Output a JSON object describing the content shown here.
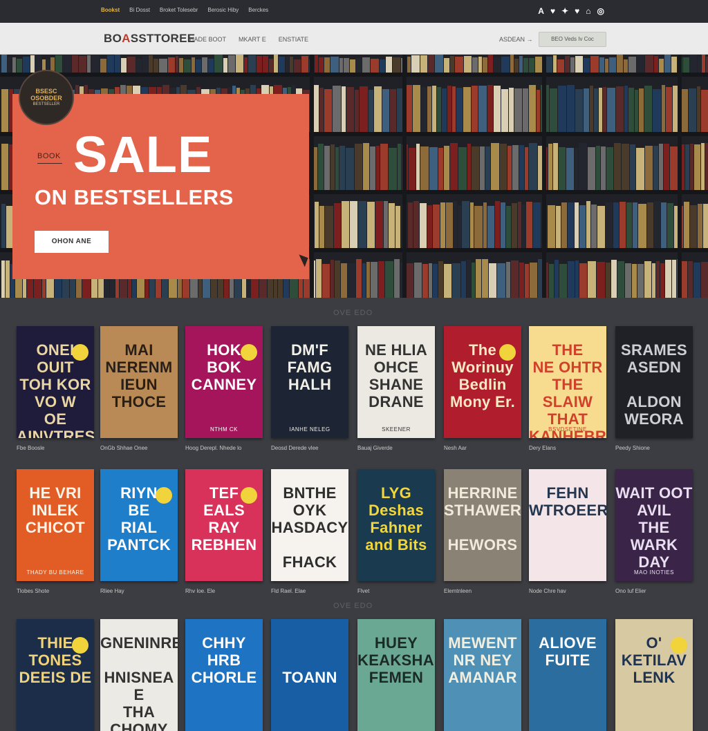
{
  "utility_bar": {
    "links": [
      "Bookst",
      "Bi Dosst",
      "Broket Tolesebr",
      "Berosic Hiby",
      "Berckes"
    ],
    "social_icons": [
      "facebook-icon",
      "twitter-icon",
      "pinterest-icon",
      "twitter-icon",
      "instagram-icon",
      "pinterest-icon"
    ],
    "social_glyphs": [
      "A",
      "♥",
      "✦",
      "♥",
      "⌂",
      "◎"
    ]
  },
  "nav": {
    "logo_prefix": "BO",
    "logo_highlight": "A",
    "logo_suffix": "SSTTOREE",
    "links": [
      "HADE BOOT",
      "MKART E",
      "ENSTIATE"
    ],
    "signin": "ASDEAN →",
    "cta": "BEO Veds Iv Coc"
  },
  "hero": {
    "badge_line1": "BSESC",
    "badge_line2": "OSOBDER",
    "badge_small": "BESTSELLER",
    "kicker": "BOOK",
    "title": "SALE",
    "subtitle": "ON BESTSELLERS",
    "button": "OHON ANE"
  },
  "sections": [
    {
      "label": "OVE EDO"
    },
    {
      "label": "OVE EDO"
    }
  ],
  "rows": [
    [
      {
        "title": "ONEI\nOUIT\nTOH KOR\nVO W\nOE\nAINVTRES",
        "caption": "Fbe Boosle",
        "bg": "#1f1b3a",
        "fg": "#e9d6a3",
        "top": "",
        "author": "",
        "sticker": true
      },
      {
        "title": "MAI\nNERENM\nIEUN\nTHOCE",
        "caption": "OnGb Shhae Onee",
        "bg": "#b98a55",
        "fg": "#2a1f17",
        "top": "",
        "author": "",
        "sticker": false
      },
      {
        "title": "HOK\nBOK\nCANNEY",
        "caption": "Hoog Derepl. Nhede lo",
        "bg": "#a4155c",
        "fg": "#ffffff",
        "top": "",
        "author": "NTHM CK",
        "sticker": true
      },
      {
        "title": "DM'F\nFAMG\nHALH",
        "caption": "Deosd Derede vlee",
        "bg": "#1d2433",
        "fg": "#f2efe6",
        "top": "",
        "author": "IANHE NELEG",
        "sticker": false
      },
      {
        "title": "NE HLIA\nOHCE\nSHANE\nDRANE",
        "caption": "Bauaj Giverde",
        "bg": "#ece9e2",
        "fg": "#333",
        "top": "",
        "author": "SKEENER",
        "sticker": false
      },
      {
        "title": "The\nWorinuy\nBedlin\nMony Er.",
        "caption": "Nesh Aar",
        "bg": "#b01d2c",
        "fg": "#f6e9c4",
        "top": "",
        "author": "",
        "sticker": true
      },
      {
        "title": "THE\nNE OHTR\nTHE\nSLAIW\nTHAT\nKANHEBR",
        "caption": "Dery Elans",
        "bg": "#f7dc8f",
        "fg": "#d1402b",
        "top": "",
        "author": "BSVDSETINE",
        "sticker": false
      },
      {
        "title": "SRAMES\nASEDN\n\nALDON\nWEORA",
        "caption": "Peedy Shione",
        "bg": "#202027",
        "fg": "#cfcfd3",
        "top": "",
        "author": "",
        "sticker": false
      }
    ],
    [
      {
        "title": "HE VRI\nINLEK\nCHICOT",
        "caption": "Tlobes Shote",
        "bg": "#e25d25",
        "fg": "#fdf3e6",
        "top": "",
        "author": "THADY BU BEHARE",
        "sticker": false
      },
      {
        "title": "RIYN\nBE\nRIAL\nPANTCK",
        "caption": "Rliee Hay",
        "bg": "#1f7ec9",
        "fg": "#ffffff",
        "top": "",
        "author": "",
        "sticker": true
      },
      {
        "title": "TEF\nEALS\nRAY\nREBHEN",
        "caption": "Rhv loe. Ele",
        "bg": "#d9325a",
        "fg": "#ffffff",
        "top": "",
        "author": "",
        "sticker": true
      },
      {
        "title": "BNTHE\nOYK\nHASDACY\n\nFHACK",
        "caption": "Fld Rael. Elae",
        "bg": "#f6f3ee",
        "fg": "#2e2e2e",
        "top": "",
        "author": "",
        "sticker": false
      },
      {
        "title": "LYG\nDeshas\nFahner\nand Bits",
        "caption": "Flvet",
        "bg": "#1a3a4f",
        "fg": "#f3d73a",
        "top": "",
        "author": "",
        "sticker": false
      },
      {
        "title": "HERRINE\nSTHAWER\n\nHEWORS",
        "caption": "Elemtnleen",
        "bg": "#8a8375",
        "fg": "#f2eadb",
        "top": "",
        "author": "",
        "sticker": false
      },
      {
        "title": "FEHN\nWTROEER",
        "caption": "Node Chre hav",
        "bg": "#f4e6e8",
        "fg": "#253650",
        "top": "",
        "author": "",
        "sticker": false
      },
      {
        "title": "WAIT OOT AVIL\nTHE\nWARK\nDAY",
        "caption": "Ono Iuf Elier",
        "bg": "#3a2447",
        "fg": "#e9dff1",
        "top": "",
        "author": "MAO INOTIES",
        "sticker": false
      }
    ],
    [
      {
        "title": "THIE TONES\nDEEIS DE",
        "caption": "",
        "bg": "#1c2d4a",
        "fg": "#f0d37a",
        "top": "",
        "author": "",
        "sticker": true
      },
      {
        "title": "GNENINREY\n\nHNISNEA E\nTHA CHOMY",
        "caption": "",
        "bg": "#eceae4",
        "fg": "#333",
        "top": "",
        "author": "",
        "sticker": false
      },
      {
        "title": "CHHY\nHRB\nCHORLE",
        "caption": "",
        "bg": "#1e73c2",
        "fg": "#ffffff",
        "top": "",
        "author": "",
        "sticker": false
      },
      {
        "title": "\n\nTOANN",
        "caption": "",
        "bg": "#185ea5",
        "fg": "#ffffff",
        "top": "",
        "author": "",
        "sticker": false
      },
      {
        "title": "HUEY\nKEAKSHAER\nFEMEN",
        "caption": "",
        "bg": "#6aa893",
        "fg": "#1c2a27",
        "top": "",
        "author": "",
        "sticker": false
      },
      {
        "title": "MEWENT\nNR NEY\nAMANAR",
        "caption": "",
        "bg": "#4f90b6",
        "fg": "#f2efe0",
        "top": "",
        "author": "",
        "sticker": false
      },
      {
        "title": "ALIOVE\nFUITE",
        "caption": "",
        "bg": "#2a6d9e",
        "fg": "#ffffff",
        "top": "",
        "author": "",
        "sticker": false
      },
      {
        "title": "O'\nKETILAV\nLENK",
        "caption": "",
        "bg": "#d7c9a2",
        "fg": "#1f3350",
        "top": "",
        "author": "",
        "sticker": true
      }
    ]
  ]
}
